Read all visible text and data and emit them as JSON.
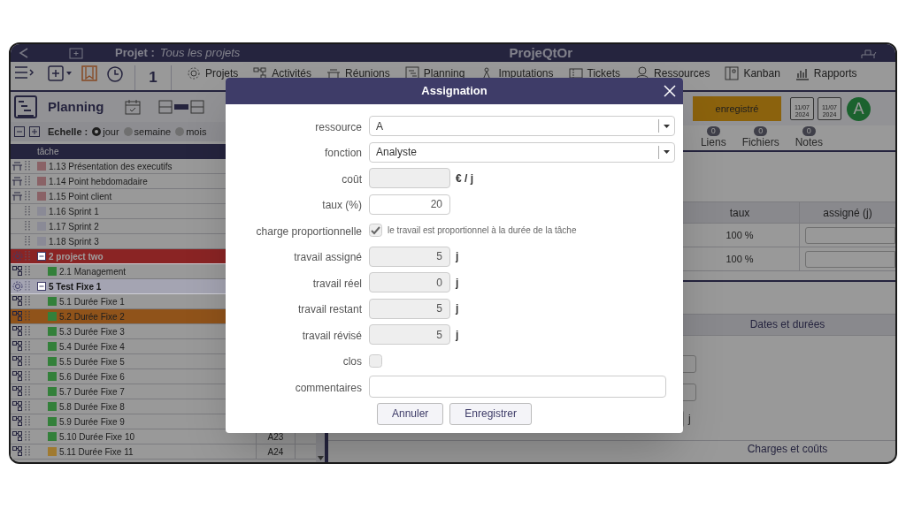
{
  "top_bar": {
    "project_label": "Projet :",
    "project_value": "Tous les projets",
    "app_title": "ProjeQtOr"
  },
  "menu": {
    "counter": "1",
    "items": [
      "Projets",
      "Activités",
      "Réunions",
      "Planning",
      "Imputations",
      "Tickets",
      "Ressources",
      "Kanban",
      "Rapports"
    ]
  },
  "planning": {
    "title": "Planning",
    "scale_label": "Echelle :",
    "scales": [
      {
        "label": "jour",
        "selected": true
      },
      {
        "label": "semaine",
        "selected": false
      },
      {
        "label": "mois",
        "selected": false
      }
    ],
    "column": "tâche",
    "tasks": [
      {
        "name": "1.13 Présentation des executifs",
        "kind": "meeting",
        "color": "#8a6266",
        "selected": false
      },
      {
        "name": "1.14 Point hebdomadaire",
        "kind": "meeting",
        "color": "#8a6266",
        "selected": false
      },
      {
        "name": "1.15 Point client",
        "kind": "meeting",
        "color": "#8a6266",
        "selected": false
      },
      {
        "name": "1.16 Sprint 1",
        "kind": "sprint",
        "color": "#8a8a96",
        "selected": false
      },
      {
        "name": "1.17 Sprint 2",
        "kind": "sprint",
        "color": "#8a8a96",
        "selected": false
      },
      {
        "name": "1.18 Sprint 3",
        "kind": "sprint",
        "color": "#8a8a96",
        "selected": false
      },
      {
        "name": "2 project two",
        "kind": "project",
        "color": "#8a2424",
        "selected": false,
        "children": [
          {
            "name": "2.1 Management",
            "kind": "activity",
            "color": "#33803a",
            "selected": false
          }
        ]
      },
      {
        "name": "5 Test Fixe 1",
        "kind": "project",
        "color": "#a4a4b2",
        "selected": false,
        "children": [
          {
            "name": "5.1 Durée Fixe 1",
            "kind": "activity",
            "color": "#33803a",
            "selected": false
          },
          {
            "name": "5.2 Durée Fixe 2",
            "kind": "activity",
            "color": "#33803a",
            "selected": true
          },
          {
            "name": "5.3 Durée Fixe 3",
            "kind": "activity",
            "color": "#33803a",
            "selected": false
          },
          {
            "name": "5.4 Durée Fixe 4",
            "kind": "activity",
            "color": "#33803a",
            "selected": false
          },
          {
            "name": "5.5 Durée Fixe 5",
            "kind": "activity",
            "color": "#33803a",
            "selected": false
          },
          {
            "name": "5.6 Durée Fixe 6",
            "kind": "activity",
            "color": "#33803a",
            "selected": false
          },
          {
            "name": "5.7 Durée Fixe 7",
            "kind": "activity",
            "color": "#33803a",
            "selected": false
          },
          {
            "name": "5.8 Durée Fixe 8",
            "kind": "activity",
            "color": "#33803a",
            "selected": false
          },
          {
            "name": "5.9 Durée Fixe 9",
            "kind": "activity",
            "color": "#33803a",
            "selected": false
          },
          {
            "name": "5.10 Durée Fixe 10",
            "kind": "activity",
            "color": "#33803a",
            "selected": false,
            "code": "A23"
          },
          {
            "name": "5.11 Durée Fixe 11",
            "kind": "activity",
            "color": "#a07a30",
            "selected": false,
            "code": "A24"
          }
        ]
      }
    ]
  },
  "detail": {
    "status": "enregistré",
    "dates": [
      {
        "day": "11/07",
        "year": "2024"
      },
      {
        "day": "11/07",
        "year": "2024"
      }
    ],
    "avatar": "A",
    "tabs": [
      {
        "label": "Liens",
        "count": "0"
      },
      {
        "label": "Fichiers",
        "count": "0"
      },
      {
        "label": "Notes",
        "count": "0"
      }
    ],
    "assignments": {
      "columns": [
        "taux",
        "assigné (j)"
      ],
      "rows": [
        {
          "rate": "100 %"
        },
        {
          "rate": "100 %"
        }
      ]
    },
    "dates_section": "Dates et durées",
    "unit": "j",
    "costs_section": "Charges et coûts"
  },
  "dialog": {
    "title": "Assignation",
    "fields": [
      {
        "label": "ressource",
        "kind": "select",
        "value": "A"
      },
      {
        "label": "fonction",
        "kind": "select",
        "value": "Analyste"
      },
      {
        "label": "coût",
        "kind": "number",
        "disabled": true,
        "unit": "€ / j"
      },
      {
        "label": "taux (%)",
        "kind": "number",
        "disabled": false,
        "value": "20"
      },
      {
        "label": "charge proportionnelle",
        "kind": "checkbox",
        "checked": true,
        "disabled": true,
        "note": "le travail est proportionnel à la durée de la tâche"
      },
      {
        "label": "travail assigné",
        "kind": "number",
        "disabled": true,
        "value": "5",
        "unit": "j"
      },
      {
        "label": "travail réel",
        "kind": "number",
        "disabled": true,
        "value": "0",
        "unit": "j"
      },
      {
        "label": "travail restant",
        "kind": "number",
        "disabled": true,
        "value": "5",
        "unit": "j"
      },
      {
        "label": "travail révisé",
        "kind": "number",
        "disabled": true,
        "value": "5",
        "unit": "j"
      },
      {
        "label": "clos",
        "kind": "checkbox",
        "checked": false,
        "disabled": true
      },
      {
        "label": "commentaires",
        "kind": "text"
      }
    ],
    "buttons": [
      "Annuler",
      "Enregistrer"
    ]
  }
}
